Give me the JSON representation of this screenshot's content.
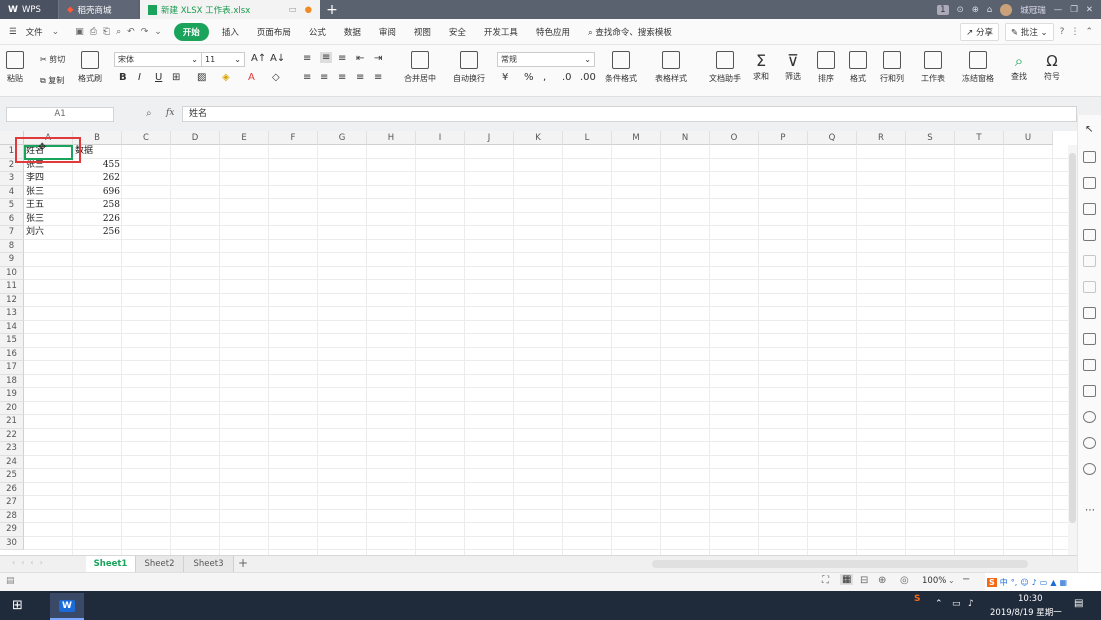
{
  "titlebar": {
    "tabs": [
      {
        "label": "WPS"
      },
      {
        "label": "稻壳商城"
      },
      {
        "label": "新建 XLSX 工作表.xlsx"
      }
    ],
    "badge": "1",
    "user": "城冠瑞"
  },
  "menubar": {
    "file": "文件",
    "items": [
      "开始",
      "插入",
      "页面布局",
      "公式",
      "数据",
      "审阅",
      "视图",
      "安全",
      "开发工具",
      "特色应用"
    ],
    "search": "查找命令、搜索模板",
    "share": "分享",
    "annotate": "批注"
  },
  "ribbon": {
    "paste": "粘贴",
    "cut": "剪切",
    "copy": "复制",
    "format_painter": "格式刷",
    "font_name": "宋体",
    "font_size": "11",
    "merge_center": "合并居中",
    "auto_wrap": "自动换行",
    "number_format": "常规",
    "conditional": "条件格式",
    "table_style": "表格样式",
    "doc_helper": "文档助手",
    "sum": "求和",
    "filter": "筛选",
    "sort": "排序",
    "format": "格式",
    "row_col": "行和列",
    "worksheet": "工作表",
    "freeze": "冻结窗格",
    "find": "查找",
    "symbol": "符号"
  },
  "formula": {
    "namebox": "A1",
    "fx": "fx",
    "content": "姓名"
  },
  "grid": {
    "columns": [
      "A",
      "B",
      "C",
      "D",
      "E",
      "F",
      "G",
      "H",
      "I",
      "J",
      "K",
      "L",
      "M",
      "N",
      "O",
      "P",
      "Q",
      "R",
      "S",
      "T",
      "U"
    ],
    "rows": [
      "1",
      "2",
      "3",
      "4",
      "5",
      "6",
      "7",
      "8",
      "9",
      "10",
      "11",
      "12",
      "13",
      "14",
      "15",
      "16",
      "17",
      "18",
      "19",
      "20",
      "21",
      "22",
      "23",
      "24",
      "25",
      "26",
      "27",
      "28",
      "29",
      "30"
    ],
    "data": [
      {
        "a": "姓名",
        "b": "数据"
      },
      {
        "a": "张三",
        "b": "455"
      },
      {
        "a": "李四",
        "b": "262"
      },
      {
        "a": "张三",
        "b": "696"
      },
      {
        "a": "王五",
        "b": "258"
      },
      {
        "a": "张三",
        "b": "226"
      },
      {
        "a": "刘六",
        "b": "256"
      }
    ]
  },
  "sheets": [
    "Sheet1",
    "Sheet2",
    "Sheet3"
  ],
  "status": {
    "zoom": "100%"
  },
  "taskbar": {
    "time": "10:30",
    "date": "2019/8/19 星期一",
    "ime": "中"
  }
}
